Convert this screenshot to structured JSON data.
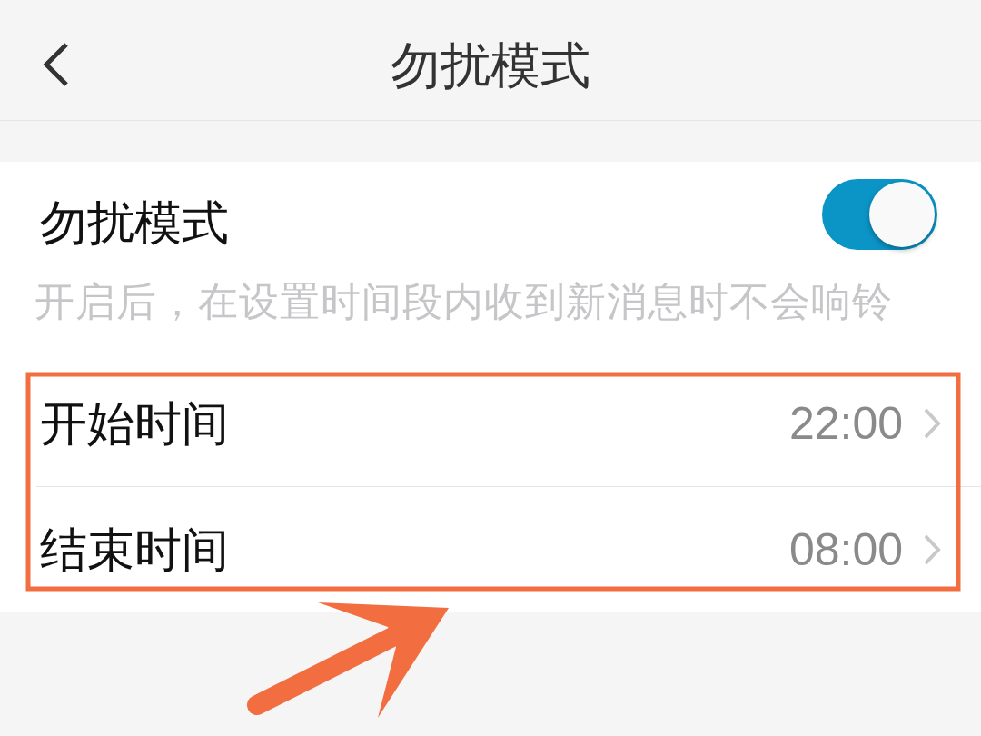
{
  "header": {
    "title": "勿扰模式"
  },
  "dnd": {
    "label": "勿扰模式",
    "on": true,
    "description": "开启后，在设置时间段内收到新消息时不会响铃"
  },
  "time_rows": [
    {
      "label": "开始时间",
      "value": "22:00"
    },
    {
      "label": "结束时间",
      "value": "08:00"
    }
  ],
  "annotations": {
    "highlight_frame": true,
    "pointer_arrow": true
  }
}
